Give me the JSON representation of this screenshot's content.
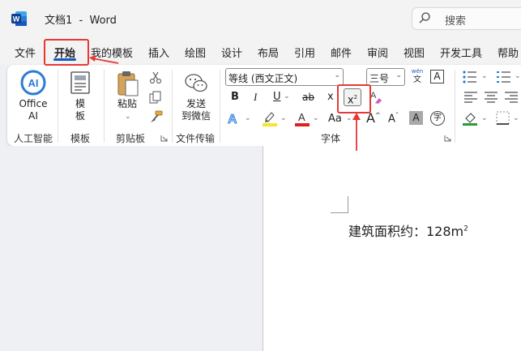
{
  "window": {
    "title": "文档1  -  Word",
    "search_label": "搜索"
  },
  "menu": {
    "items": [
      "文件",
      "开始",
      "我的模板",
      "插入",
      "绘图",
      "设计",
      "布局",
      "引用",
      "邮件",
      "审阅",
      "视图",
      "开发工具",
      "帮助"
    ],
    "active": "开始"
  },
  "ribbon": {
    "groups": {
      "ai": {
        "label": "人工智能",
        "button_line1": "Office",
        "button_line2": "AI"
      },
      "template": {
        "label": "模板",
        "button_line1": "模",
        "button_line2": "板"
      },
      "clipboard": {
        "label": "剪贴板",
        "paste_label": "粘贴"
      },
      "filetransfer": {
        "label": "文件传输",
        "button_line1": "发送",
        "button_line2": "到微信"
      },
      "font": {
        "label": "字体",
        "font_name": "等线 (西文正文)",
        "font_size": "三号",
        "wen_label": "wén",
        "bold": "B",
        "italic": "I",
        "underline": "U",
        "strike": "ab",
        "subscript": "x",
        "superscript": "x",
        "superscript_mark": "2",
        "case": "Aa",
        "grow": "A",
        "shrink": "A",
        "char_border": "A",
        "phonetic": "字"
      }
    },
    "colors": {
      "highlight": "#f5e62c",
      "font_color": "#e02020",
      "accent": "#185abd"
    }
  },
  "document": {
    "text": "建筑面积约：128m",
    "superscript": "2"
  }
}
